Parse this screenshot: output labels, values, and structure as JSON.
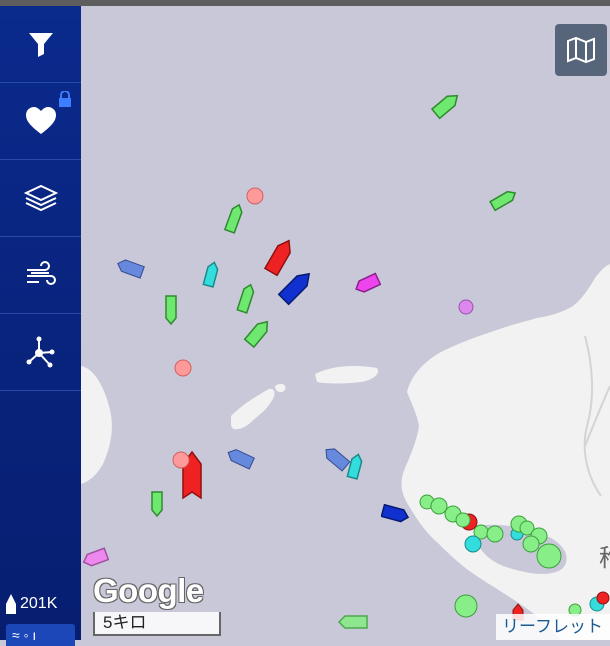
{
  "sidebar": {
    "items": [
      {
        "icon": "filter-icon"
      },
      {
        "icon": "heart-icon",
        "locked": true
      },
      {
        "icon": "layers-icon"
      },
      {
        "icon": "wind-icon"
      },
      {
        "icon": "network-icon"
      }
    ],
    "vessel_count": "201K",
    "bottom_label": "≈ ◦ ı"
  },
  "map": {
    "google_label": "Google",
    "scale_label": "5キロ",
    "attribution": "リーフレット",
    "place_char": "稚",
    "colors": {
      "water": "#c9c8d8",
      "land": "#f2f2f2",
      "cargo": "#6ee86e",
      "tanker": "#ee2222",
      "passenger": "#1030d0",
      "fishing": "#ee44ee",
      "special": "#33dddd",
      "unknown": "#6688dd"
    }
  }
}
